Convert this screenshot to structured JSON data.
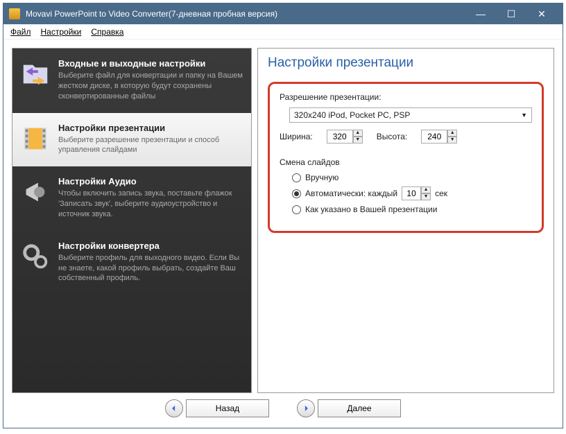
{
  "window": {
    "title": "Movavi PowerPoint to Video Converter(7-дневная пробная версия)"
  },
  "menu": {
    "file": "Файл",
    "settings": "Настройки",
    "help": "Справка"
  },
  "sidebar": {
    "items": [
      {
        "title": "Входные и выходные настройки",
        "desc": "Выберите файл для конвертации и папку на Вашем жестком диске, в которую будут сохранены сконвертированные файлы"
      },
      {
        "title": "Настройки презентации",
        "desc": "Выберите разрешение презентации и способ управления слайдами"
      },
      {
        "title": "Настройки Аудио",
        "desc": "Чтобы включить запись звука, поставьте флажок 'Записать звук', выберите аудиоустройство и источник звука."
      },
      {
        "title": "Настройки конвертера",
        "desc": "Выберите профиль для выходного видео. Если Вы не знаете, какой профиль выбрать, создайте Ваш собственный профиль."
      }
    ]
  },
  "main": {
    "heading": "Настройки презентации",
    "resolution_label": "Разрешение презентации:",
    "resolution_value": "320x240 iPod, Pocket PC, PSP",
    "width_label": "Ширина:",
    "width_value": "320",
    "height_label": "Высота:",
    "height_value": "240",
    "slides_label": "Смена слайдов",
    "radio_manual": "Вручную",
    "radio_auto_prefix": "Автоматически: каждый",
    "radio_auto_value": "10",
    "radio_auto_suffix": "сек",
    "radio_asis": "Как указано в Вашей презентации"
  },
  "nav": {
    "back": "Назад",
    "next": "Далее"
  }
}
